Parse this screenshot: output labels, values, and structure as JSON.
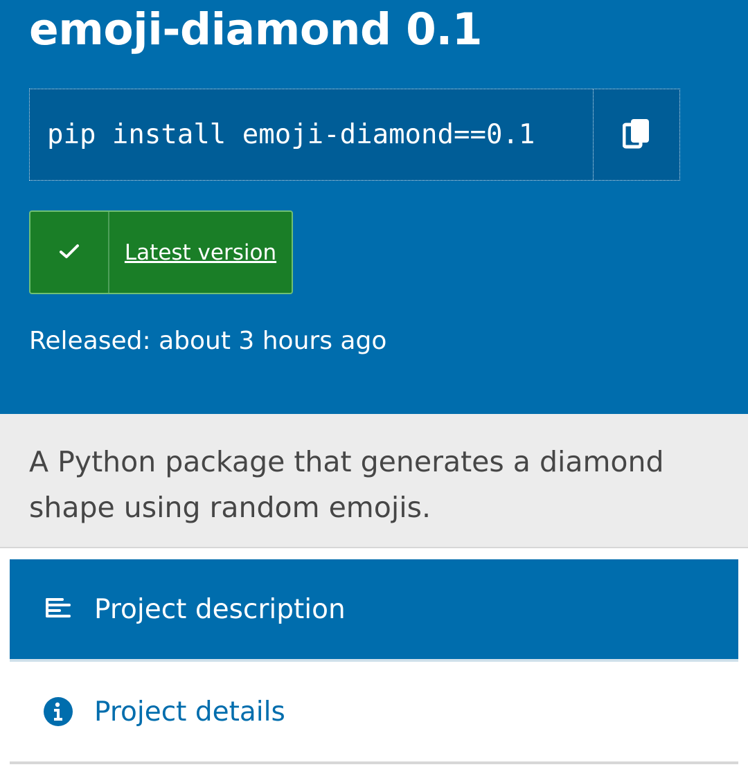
{
  "header": {
    "title": "emoji-diamond 0.1",
    "pip_command": "pip install emoji-diamond==0.1",
    "copy_icon": "copy-icon",
    "badge": {
      "icon": "check-icon",
      "label": "Latest version"
    },
    "released": "Released: about 3 hours ago"
  },
  "summary": {
    "text": "A Python package that generates a diamond shape using random emojis."
  },
  "nav": {
    "items": [
      {
        "label": "Project description",
        "icon": "align-left-icon",
        "active": true
      },
      {
        "label": "Project details",
        "icon": "info-icon",
        "active": false
      }
    ]
  },
  "colors": {
    "brand_blue": "#006dad",
    "pip_bg": "#005d97",
    "badge_green": "#1a7e27",
    "summary_bg": "#ececec"
  }
}
